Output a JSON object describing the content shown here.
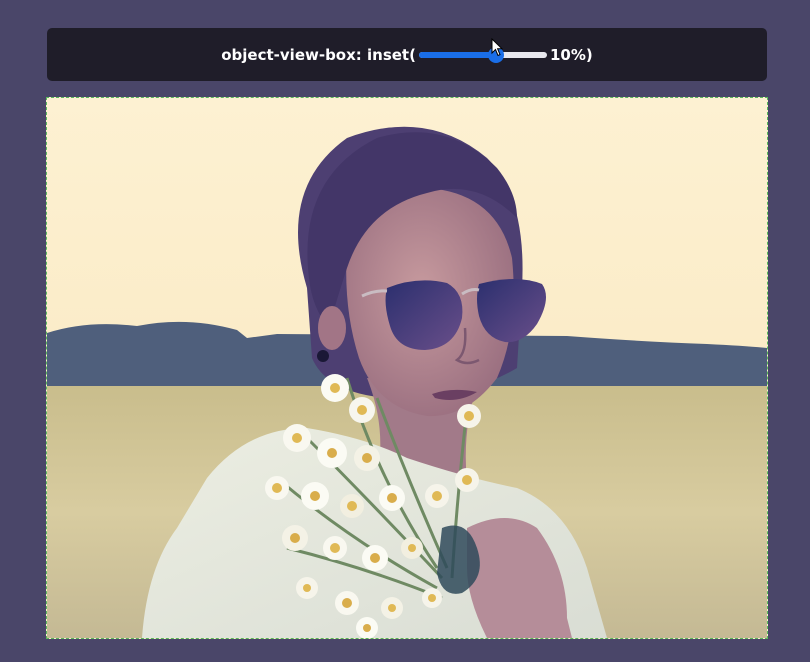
{
  "control": {
    "prefix": "object-view-box: inset(",
    "value_text": "10%",
    "suffix": ")",
    "slider_value_fraction": 0.6
  },
  "image": {
    "alt": "woman-with-sunglasses-holding-daisies"
  },
  "colors": {
    "page_background": "#4a4669",
    "bar_background": "#1f1d29",
    "slider_accent": "#1a6ee8",
    "frame_border": "#59b85a"
  }
}
